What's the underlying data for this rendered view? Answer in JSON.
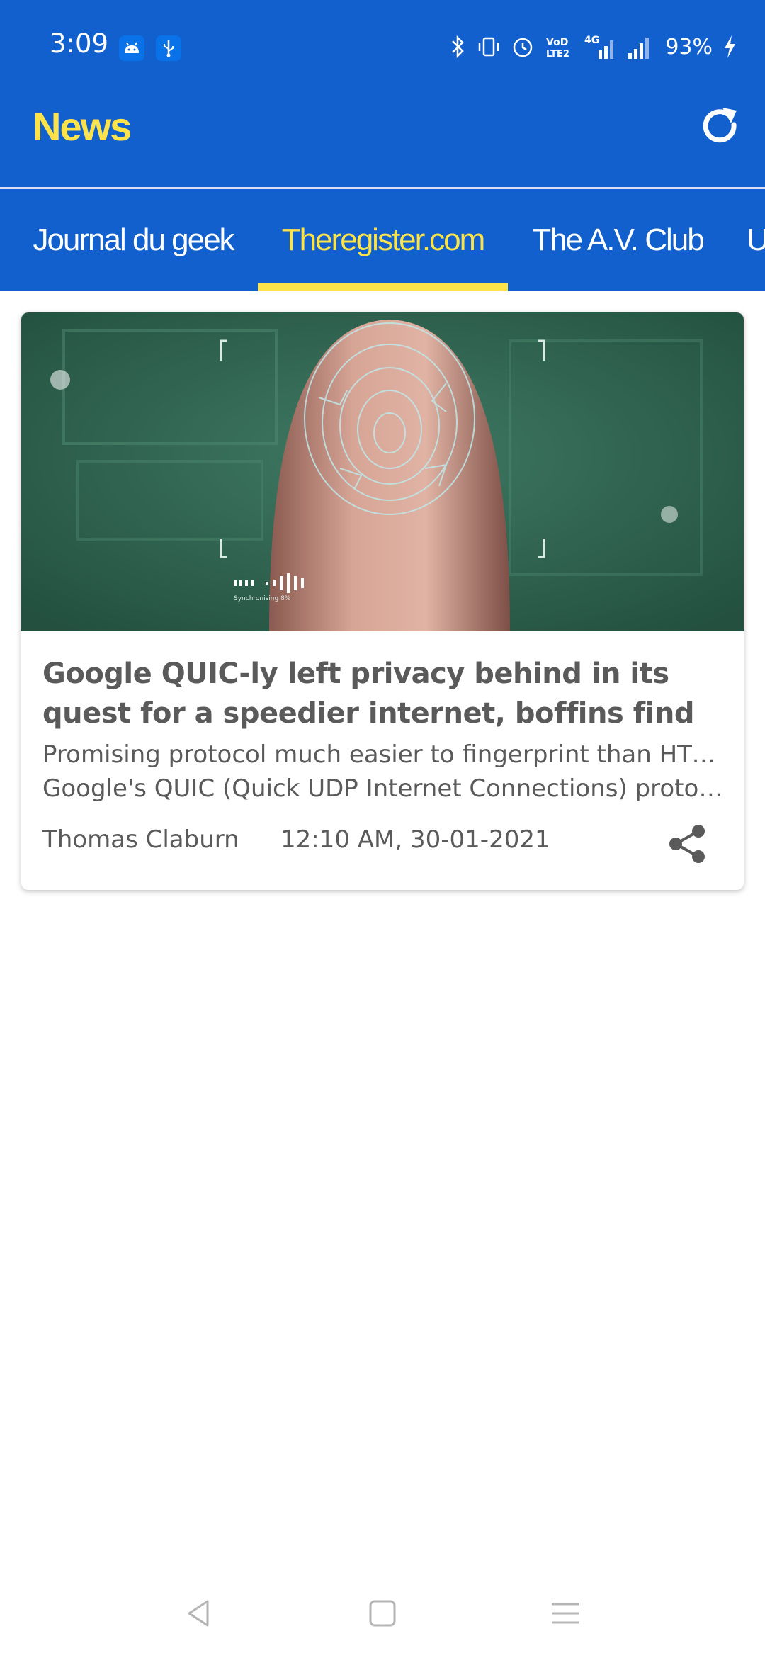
{
  "status_bar": {
    "time": "3:09",
    "network_label": "4G",
    "volte_label": "VoLTE2",
    "battery": "93%",
    "icons": [
      "android-icon",
      "usb-icon",
      "bluetooth-icon",
      "vibrate-icon",
      "alarm-icon",
      "volte-icon",
      "signal-4g-icon",
      "signal-icon",
      "charging-icon"
    ]
  },
  "header": {
    "title": "News",
    "refresh_icon": "refresh-icon"
  },
  "tabs": [
    {
      "label": "Journal du geek",
      "active": false
    },
    {
      "label": "Theregister.com",
      "active": true
    },
    {
      "label": "The A.V. Club",
      "active": false
    },
    {
      "label": "U",
      "active": false
    }
  ],
  "article": {
    "title": "Google QUIC-ly left privacy behind in its quest for a speedier internet, boffins find",
    "summary_line1": "Promising protocol much easier to fingerprint than HTTPS",
    "summary_line2": "Google's QUIC (Quick UDP Internet Connections) protocol found",
    "author": "Thomas Claburn",
    "datetime": "12:10 AM, 30-01-2021",
    "share_icon": "share-icon",
    "image_overlay_text": "Synchronising 8%"
  },
  "colors": {
    "primary": "#1160cd",
    "accent": "#fde34a",
    "text": "#5a5a5a"
  },
  "nav": [
    "back-icon",
    "home-icon",
    "menu-icon"
  ]
}
